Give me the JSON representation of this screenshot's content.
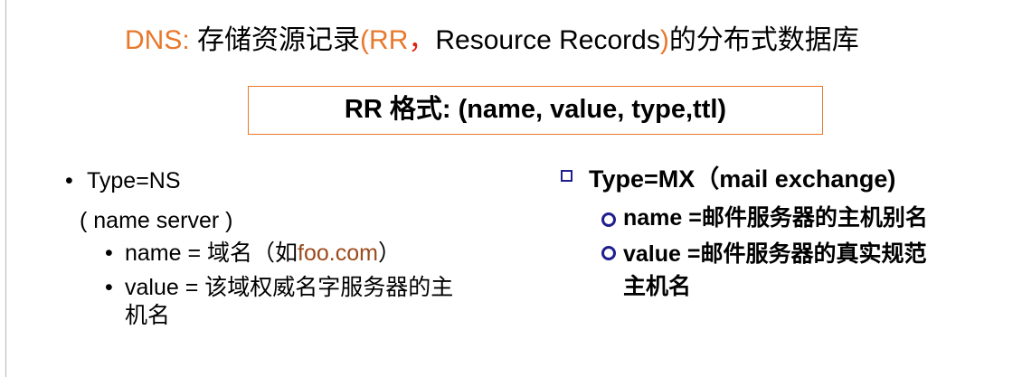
{
  "title": {
    "dns": "DNS:",
    "part1": " 存储资源记录",
    "paren_open": "(",
    "rr": "RR",
    "comma": "，",
    "resource_records": "Resource Records",
    "paren_close": ")",
    "part2": "的分布式数据库"
  },
  "format_box": {
    "text": "RR 格式: (name, value, type,ttl)"
  },
  "left": {
    "type_label": "Type=NS",
    "type_desc": "( name server )",
    "name_prefix": "name = 域名（如",
    "name_example": "foo.com",
    "name_suffix": "）",
    "value_line1": "value = 该域权威名字服务器的主",
    "value_line2": "机名"
  },
  "right": {
    "type_label": "Type=MX（mail exchange)",
    "name_item": "name =邮件服务器的主机别名",
    "value_line1": "value =邮件服务器的真实规范",
    "value_line2": "主机名"
  }
}
